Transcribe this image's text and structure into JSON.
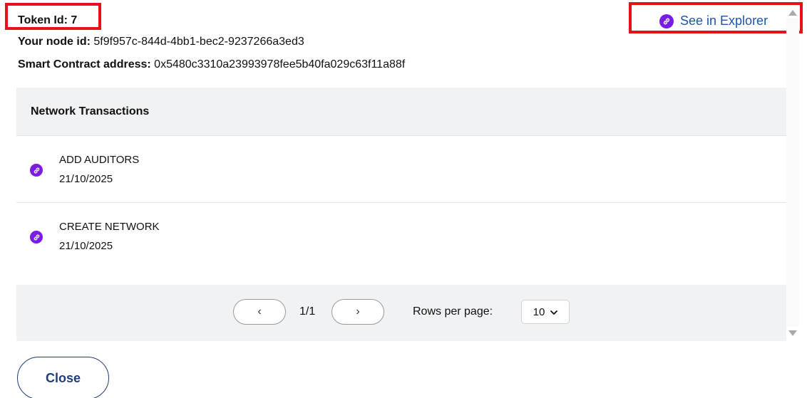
{
  "header": {
    "token_id": "Token Id: 7",
    "node_id_label": "Your node id:",
    "node_id_value": "5f9f957c-844d-4bb1-bec2-9237266a3ed3",
    "contract_label": "Smart Contract address:",
    "contract_value": "0x5480c3310a23993978fee5b40fa029c63f11a88f",
    "explorer_link": "See in Explorer"
  },
  "transactions": {
    "title": "Network Transactions",
    "rows": [
      {
        "action": "ADD AUDITORS",
        "date": "21/10/2025"
      },
      {
        "action": "CREATE NETWORK",
        "date": "21/10/2025"
      }
    ],
    "pagination": {
      "prev": "‹",
      "next": "›",
      "page": "1/1",
      "rows_label": "Rows per page:",
      "rows_value": "10"
    }
  },
  "actions": {
    "close_label": "Close"
  },
  "icons": {
    "link": "link-icon",
    "chevron_down": "chevron-down-icon",
    "scroll_up": "scroll-up-arrow",
    "scroll_down": "scroll-down-arrow"
  },
  "colors": {
    "highlight_border": "#e8111b",
    "link_icon_bg": "#7a1be6",
    "link_text": "#1d55a8",
    "close_button": "#1d3f7a",
    "panel_bg": "#f1f2f4"
  }
}
